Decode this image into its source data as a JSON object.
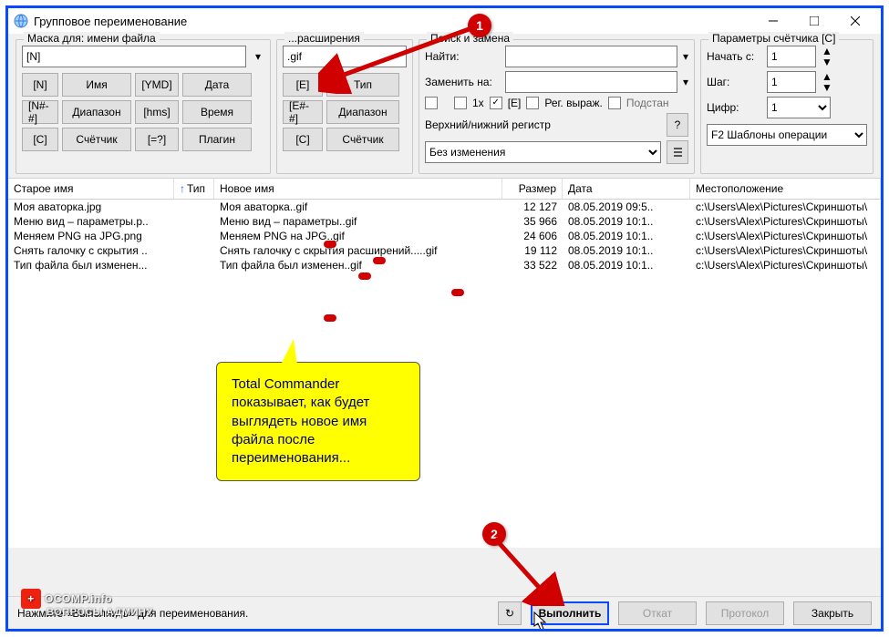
{
  "window": {
    "title": "Групповое переименование"
  },
  "mask": {
    "legend": "Маска для: имени файла",
    "value": "[N]",
    "buttons": {
      "n": "[N]",
      "name": "Имя",
      "ymd": "[YMD]",
      "date": "Дата",
      "range": "[N#-#]",
      "rangeLbl": "Диапазон",
      "hms": "[hms]",
      "time": "Время",
      "c": "[C]",
      "counter": "Счётчик",
      "eq": "[=?]",
      "plugin": "Плагин"
    }
  },
  "ext": {
    "legend": "...расширения",
    "value": ".gif",
    "buttons": {
      "e": "[E]",
      "type": "Тип",
      "range": "[E#-#]",
      "rangeLbl": "Диапазон",
      "c": "[C]",
      "counter": "Счётчик"
    }
  },
  "search": {
    "legend": "Поиск и замена",
    "findLbl": "Найти:",
    "replaceLbl": "Заменить на:",
    "findVal": "",
    "replaceVal": "",
    "chk1x": "1x",
    "chkE": "[E]",
    "chkRegex": "Рег. выраж.",
    "chkSubst": "Подстан",
    "caseLbl": "Верхний/нижний регистр",
    "caseVal": "Без изменения"
  },
  "counter": {
    "legend": "Параметры счётчика [C]",
    "startLbl": "Начать с:",
    "startVal": "1",
    "stepLbl": "Шаг:",
    "stepVal": "1",
    "digitsLbl": "Цифр:",
    "digitsVal": "1",
    "templatesBtn": "F2 Шаблоны операции"
  },
  "columns": {
    "old": "Старое имя",
    "type": "Тип",
    "new": "Новое имя",
    "size": "Размер",
    "date": "Дата",
    "loc": "Местоположение"
  },
  "rows": [
    {
      "old": "Моя аваторка.jpg",
      "new": "Моя аваторка..gif",
      "size": "12 127",
      "date": "08.05.2019 09:5..",
      "loc": "c:\\Users\\Alex\\Pictures\\Скриншоты\\"
    },
    {
      "old": "Меню вид – параметры.p..",
      "new": "Меню вид – параметры..gif",
      "size": "35 966",
      "date": "08.05.2019 10:1..",
      "loc": "c:\\Users\\Alex\\Pictures\\Скриншоты\\"
    },
    {
      "old": "Меняем PNG на JPG.png",
      "new": "Меняем PNG на JPG..gif",
      "size": "24 606",
      "date": "08.05.2019 10:1..",
      "loc": "c:\\Users\\Alex\\Pictures\\Скриншоты\\"
    },
    {
      "old": "Снять галочку с скрытия ..",
      "new": "Снять галочку с скрытия расширений.....gif",
      "size": "19 112",
      "date": "08.05.2019 10:1..",
      "loc": "c:\\Users\\Alex\\Pictures\\Скриншоты\\"
    },
    {
      "old": "Тип файла был изменен...",
      "new": "Тип файла был изменен..gif",
      "size": "33 522",
      "date": "08.05.2019 10:1..",
      "loc": "c:\\Users\\Alex\\Pictures\\Скриншоты\\"
    }
  ],
  "footer": {
    "status": "Нажмите «Выполнить» для переименования.",
    "run": "Выполнить",
    "undo": "Откат",
    "log": "Протокол",
    "close": "Закрыть"
  },
  "annotations": {
    "bubble1": "1",
    "bubble2": "2",
    "callout": "Total Commander показывает, как будет выглядеть новое имя файла после переименования..."
  },
  "watermark": {
    "main": "OCOMP.info",
    "sub": "ВОПРОСЫ АДМИНУ"
  }
}
